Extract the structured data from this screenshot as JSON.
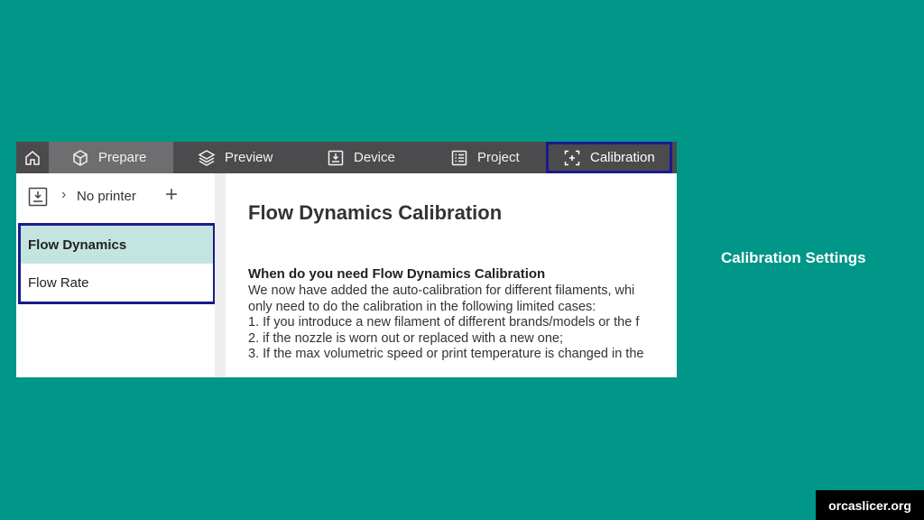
{
  "tabs": {
    "home_icon": "home-icon",
    "prepare": "Prepare",
    "preview": "Preview",
    "device": "Device",
    "project": "Project",
    "calibration": "Calibration"
  },
  "sidebar": {
    "printer_label": "No printer",
    "items": [
      "Flow Dynamics",
      "Flow Rate"
    ]
  },
  "content": {
    "title": "Flow Dynamics Calibration",
    "subtitle": "When do you need Flow Dynamics Calibration",
    "lines": [
      "We now have added the auto-calibration for different filaments, whi",
      "only need to do the calibration in the following limited cases:",
      "1. If you introduce a new filament of different brands/models or the f",
      "2. if the nozzle is worn out or replaced with a new one;",
      "3. If the max volumetric speed or print temperature is changed in the"
    ]
  },
  "caption": "Calibration Settings",
  "badge": "orcaslicer.org",
  "colors": {
    "background": "#009688",
    "tabbar": "#4b4b4d",
    "active_tab": "#6e6e70",
    "highlight_border": "#1a1a8c",
    "selected_item": "#c4e4df"
  }
}
